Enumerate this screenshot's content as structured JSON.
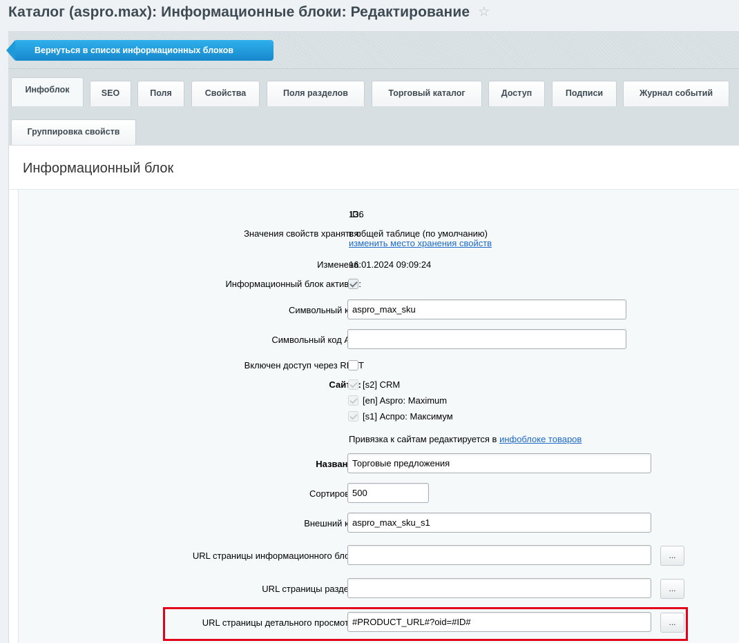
{
  "header": {
    "title": "Каталог (aspro.max): Информационные блоки: Редактирование",
    "star_icon": "star-icon"
  },
  "toolbar": {
    "back_label": "Вернуться в список информационных блоков"
  },
  "tabs": [
    {
      "label": "Инфоблок",
      "active": true
    },
    {
      "label": "SEO"
    },
    {
      "label": "Поля"
    },
    {
      "label": "Свойства"
    },
    {
      "label": "Поля разделов"
    },
    {
      "label": "Торговый каталог"
    },
    {
      "label": "Доступ"
    },
    {
      "label": "Подписи"
    },
    {
      "label": "Журнал событий"
    },
    {
      "label": "Группировка свойств"
    }
  ],
  "section": {
    "title": "Информационный блок"
  },
  "form": {
    "id_label": "ID:",
    "id_value": "136",
    "storage_label": "Значения свойств хранятся:",
    "storage_value": "в общей таблице (по умолчанию)",
    "storage_link": "изменить место хранения свойств",
    "modified_label": "Изменена:",
    "modified_value": "16.01.2024 09:09:24",
    "active_label": "Информационный блок активен:",
    "active_checked": true,
    "code_label": "Символьный код:",
    "code_value": "aspro_max_sku",
    "api_code_label": "Символьный код API:",
    "api_code_value": "",
    "rest_label": "Включен доступ через REST",
    "rest_checked": false,
    "sites_label": "Сайты:",
    "sites": [
      {
        "label": "[s2] CRM",
        "checked": true
      },
      {
        "label": "[en] Aspro: Maximum",
        "checked": true
      },
      {
        "label": "[s1] Аспро: Максимум",
        "checked": true
      }
    ],
    "sites_note_prefix": "Привязка к сайтам редактируется в",
    "sites_note_link": "инфоблоке товаров",
    "name_label": "Название:",
    "name_value": "Торговые предложения",
    "sort_label": "Сортировка:",
    "sort_value": "500",
    "ext_code_label": "Внешний код:",
    "ext_code_value": "aspro_max_sku_s1",
    "list_url_label": "URL страницы информационного блока:",
    "list_url_value": "",
    "section_url_label": "URL страницы раздела:",
    "section_url_value": "",
    "detail_url_label": "URL страницы детального просмотра:",
    "detail_url_value": "#PRODUCT_URL#?oid=#ID#",
    "dots_label": "..."
  }
}
